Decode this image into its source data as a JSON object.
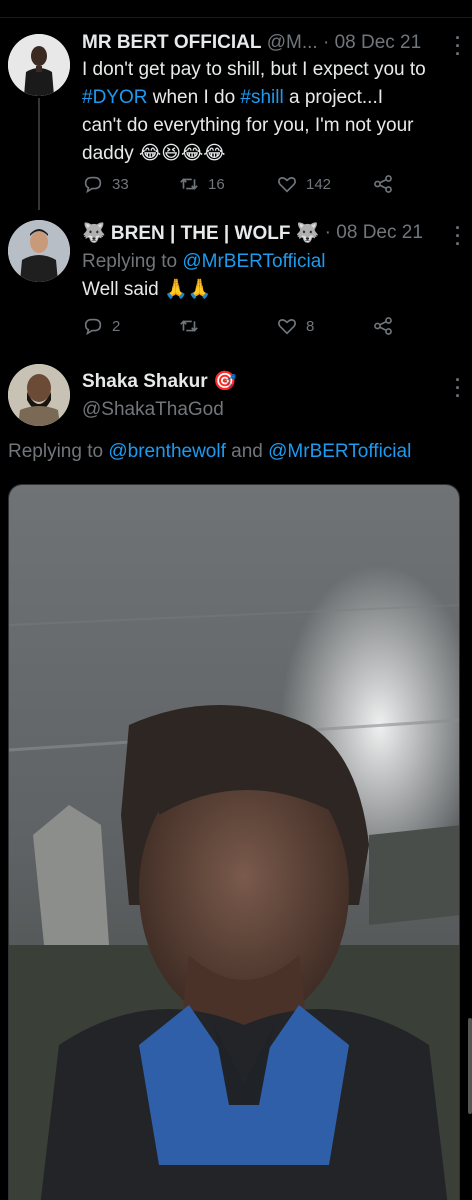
{
  "tweets": [
    {
      "name": "MR BERT OFFICIAL",
      "handle": "@M...",
      "separator": "·",
      "date": "08 Dec 21",
      "body_lines": {
        "l1": "I don't get pay to shill, but I expect you to",
        "l2_tag1": "#DYOR",
        "l2_mid": " when I do ",
        "l2_tag2": "#shill",
        "l2_end": " a project...I",
        "l3": "can't do everything for you, I'm not your",
        "l4": "daddy 😂😆😂😂"
      },
      "replies": "33",
      "retweets": "16",
      "likes": "142"
    },
    {
      "name": "🐺 BREN | THE | WOLF 🐺",
      "separator": "·",
      "date": "08 Dec 21",
      "replying_prefix": "Replying to ",
      "replying_to": "@MrBERTofficial",
      "body": "Well said 🙏🙏",
      "replies": "2",
      "retweets": "",
      "likes": "8"
    },
    {
      "name": "Shaka Shakur 🎯",
      "handle": "@ShakaThaGod",
      "replying_prefix": "Replying to ",
      "replying_to_1": "@brenthewolf",
      "replying_and": " and ",
      "replying_to_2": "@MrBERTofficial"
    }
  ],
  "colors": {
    "background": "#000000",
    "text": "#e7e9ea",
    "muted": "#71767b",
    "link": "#1d9bf0"
  },
  "icons": [
    "reply-icon",
    "retweet-icon",
    "like-icon",
    "share-icon",
    "more-icon"
  ]
}
